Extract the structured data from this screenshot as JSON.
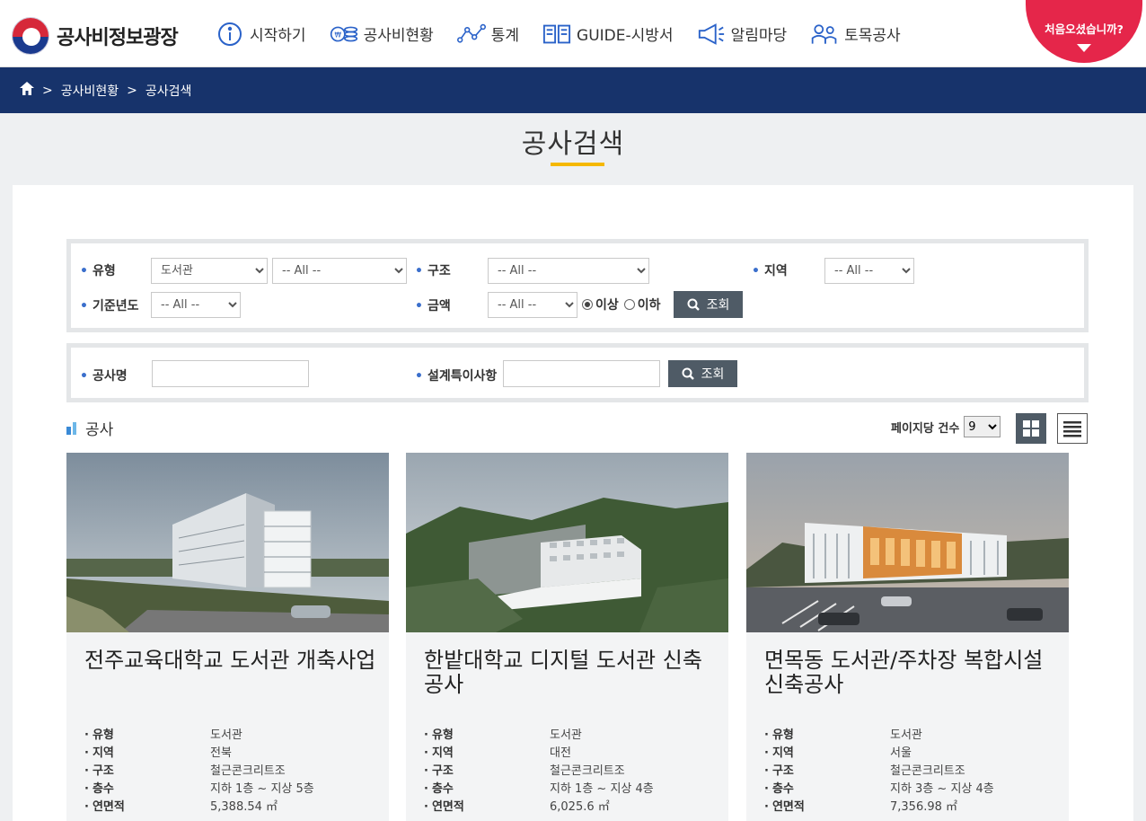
{
  "header": {
    "logo_text": "공사비정보광장",
    "nav": [
      {
        "label": "시작하기",
        "icon": "info-icon"
      },
      {
        "label": "공사비현황",
        "icon": "coins-icon"
      },
      {
        "label": "통계",
        "icon": "stats-graph-icon"
      },
      {
        "label": "GUIDE-시방서",
        "icon": "book-icon"
      },
      {
        "label": "알림마당",
        "icon": "megaphone-icon"
      },
      {
        "label": "토목공사",
        "icon": "workers-icon"
      }
    ],
    "welcome_label": "처음오셨습니까?"
  },
  "breadcrumb": [
    "공사비현황",
    "공사검색"
  ],
  "page_title": "공사검색",
  "filters": {
    "type_label": "유형",
    "type_value": "도서관",
    "subtype_value": "-- All --",
    "structure_label": "구조",
    "structure_value": "-- All --",
    "region_label": "지역",
    "region_value": "-- All --",
    "year_label": "기준년도",
    "year_value": "-- All --",
    "amount_label": "금액",
    "amount_value": "-- All --",
    "above_label": "이상",
    "below_label": "이하",
    "search_label": "조회",
    "name_label": "공사명",
    "design_label": "설계특이사항",
    "search2_label": "조회"
  },
  "list": {
    "section_title": "공사",
    "per_page_label": "페이지당 건수",
    "per_page_value": "9"
  },
  "cards": [
    {
      "title": "전주교육대학교 도서관 개축사업",
      "rows": [
        {
          "key": "유형",
          "val": "도서관"
        },
        {
          "key": "지역",
          "val": "전북"
        },
        {
          "key": "구조",
          "val": "철근콘크리트조"
        },
        {
          "key": "층수",
          "val": "지하 1층 ~ 지상 5층"
        },
        {
          "key": "연면적",
          "val": "5,388.54 ㎡"
        }
      ]
    },
    {
      "title": "한밭대학교 디지털 도서관 신축공사",
      "rows": [
        {
          "key": "유형",
          "val": "도서관"
        },
        {
          "key": "지역",
          "val": "대전"
        },
        {
          "key": "구조",
          "val": "철근콘크리트조"
        },
        {
          "key": "층수",
          "val": "지하 1층 ~ 지상 4층"
        },
        {
          "key": "연면적",
          "val": "6,025.6 ㎡"
        }
      ]
    },
    {
      "title": "면목동 도서관/주차장 복합시설 신축공사",
      "rows": [
        {
          "key": "유형",
          "val": "도서관"
        },
        {
          "key": "지역",
          "val": "서울"
        },
        {
          "key": "구조",
          "val": "철근콘크리트조"
        },
        {
          "key": "층수",
          "val": "지하 3층 ~ 지상 4층"
        },
        {
          "key": "연면적",
          "val": "7,356.98 ㎡"
        }
      ]
    }
  ],
  "colors": {
    "navy": "#17336b",
    "accent_red": "#e5264a",
    "underline_yellow": "#f5b800",
    "button_gray": "#4f5b66",
    "icon_blue": "#2a62c9"
  }
}
